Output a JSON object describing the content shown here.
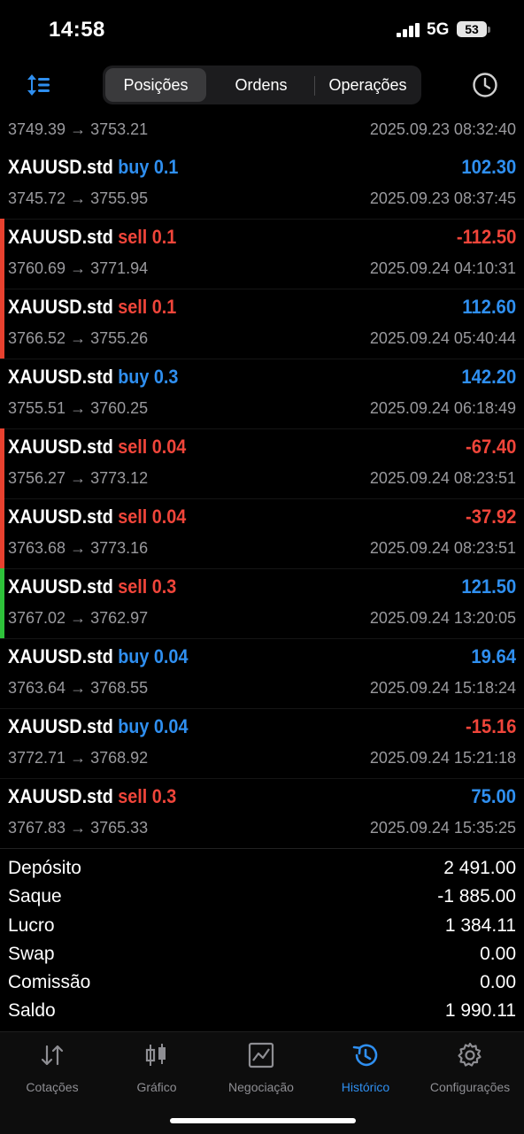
{
  "status": {
    "time": "14:58",
    "network": "5G",
    "battery": "53"
  },
  "toolbar": {
    "tabs": [
      {
        "label": "Posições",
        "active": true
      },
      {
        "label": "Ordens",
        "active": false
      },
      {
        "label": "Operações",
        "active": false
      }
    ],
    "icons": {
      "sort": "sort-icon",
      "history": "clock-icon"
    }
  },
  "trades_partial": {
    "prices": "3749.39 → 3753.21",
    "time": "2025.09.23 08:32:40"
  },
  "trades": [
    {
      "symbol": "XAUUSD.std",
      "side": "buy 0.1",
      "side_color": "blue",
      "profit": "102.30",
      "profit_color": "blue",
      "prices": "3745.72 → 3755.95",
      "time": "2025.09.23 08:37:45",
      "bar": ""
    },
    {
      "symbol": "XAUUSD.std",
      "side": "sell 0.1",
      "side_color": "red",
      "profit": "-112.50",
      "profit_color": "red",
      "prices": "3760.69 → 3771.94",
      "time": "2025.09.24 04:10:31",
      "bar": "#e8412f"
    },
    {
      "symbol": "XAUUSD.std",
      "side": "sell 0.1",
      "side_color": "red",
      "profit": "112.60",
      "profit_color": "blue",
      "prices": "3766.52 → 3755.26",
      "time": "2025.09.24 05:40:44",
      "bar": "#e8412f"
    },
    {
      "symbol": "XAUUSD.std",
      "side": "buy 0.3",
      "side_color": "blue",
      "profit": "142.20",
      "profit_color": "blue",
      "prices": "3755.51 → 3760.25",
      "time": "2025.09.24 06:18:49",
      "bar": ""
    },
    {
      "symbol": "XAUUSD.std",
      "side": "sell 0.04",
      "side_color": "red",
      "profit": "-67.40",
      "profit_color": "red",
      "prices": "3756.27 → 3773.12",
      "time": "2025.09.24 08:23:51",
      "bar": "#e8412f"
    },
    {
      "symbol": "XAUUSD.std",
      "side": "sell 0.04",
      "side_color": "red",
      "profit": "-37.92",
      "profit_color": "red",
      "prices": "3763.68 → 3773.16",
      "time": "2025.09.24 08:23:51",
      "bar": "#e8412f"
    },
    {
      "symbol": "XAUUSD.std",
      "side": "sell 0.3",
      "side_color": "red",
      "profit": "121.50",
      "profit_color": "blue",
      "prices": "3767.02 → 3762.97",
      "time": "2025.09.24 13:20:05",
      "bar": "#2ec23a"
    },
    {
      "symbol": "XAUUSD.std",
      "side": "buy 0.04",
      "side_color": "blue",
      "profit": "19.64",
      "profit_color": "blue",
      "prices": "3763.64 → 3768.55",
      "time": "2025.09.24 15:18:24",
      "bar": ""
    },
    {
      "symbol": "XAUUSD.std",
      "side": "buy 0.04",
      "side_color": "blue",
      "profit": "-15.16",
      "profit_color": "red",
      "prices": "3772.71 → 3768.92",
      "time": "2025.09.24 15:21:18",
      "bar": ""
    },
    {
      "symbol": "XAUUSD.std",
      "side": "sell 0.3",
      "side_color": "red",
      "profit": "75.00",
      "profit_color": "blue",
      "prices": "3767.83 → 3765.33",
      "time": "2025.09.24 15:35:25",
      "bar": ""
    }
  ],
  "summary": [
    {
      "label": "Depósito",
      "value": "2 491.00"
    },
    {
      "label": "Saque",
      "value": "-1 885.00"
    },
    {
      "label": "Lucro",
      "value": "1 384.11"
    },
    {
      "label": "Swap",
      "value": "0.00"
    },
    {
      "label": "Comissão",
      "value": "0.00"
    },
    {
      "label": "Saldo",
      "value": "1 990.11"
    }
  ],
  "tabbar": [
    {
      "label": "Cotações",
      "icon": "quotes-icon",
      "active": false
    },
    {
      "label": "Gráfico",
      "icon": "chart-icon",
      "active": false
    },
    {
      "label": "Negociação",
      "icon": "trade-icon",
      "active": false
    },
    {
      "label": "Histórico",
      "icon": "history-icon",
      "active": true
    },
    {
      "label": "Configurações",
      "icon": "settings-icon",
      "active": false
    }
  ],
  "colors": {
    "accent": "#2f8ff0",
    "loss": "#f0453a",
    "win_bar": "#2ec23a"
  }
}
